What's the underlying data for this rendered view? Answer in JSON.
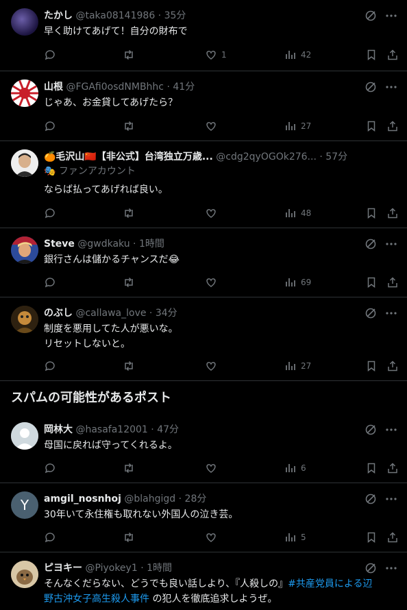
{
  "section_title": "スパムの可能性があるポスト",
  "tweets": [
    {
      "name": "たかし",
      "handle": "@taka08141986",
      "time": "35分",
      "text": [
        "早く助けてあげて！自分の財布で"
      ],
      "likes": "1",
      "views": "42"
    },
    {
      "name": "山根",
      "handle": "@FGAfi0osdNMBhhc",
      "time": "41分",
      "text": [
        "じゃあ、お金貸してあげたら？"
      ],
      "likes": "",
      "views": "27"
    },
    {
      "name": "🍊毛沢山🇨🇳【非公式】台湾独立万歳...",
      "handle": "@cdg2qyOGOk276...",
      "time": "57分",
      "sub": "ファンアカウント",
      "text": [
        "ならば払ってあげれば良い。"
      ],
      "likes": "",
      "views": "48"
    },
    {
      "name": "Steve",
      "handle": "@gwdkaku",
      "time": "1時間",
      "text": [
        "銀行さんは儲かるチャンスだ😂"
      ],
      "likes": "",
      "views": "69"
    },
    {
      "name": "のぶし",
      "handle": "@callawa_love",
      "time": "34分",
      "text": [
        "制度を悪用してた人が悪いな。",
        "リセットしないと。"
      ],
      "likes": "",
      "views": "27"
    },
    {
      "name": "岡林大",
      "handle": "@hasafa12001",
      "time": "47分",
      "text": [
        "母国に戻れば守ってくれるよ。"
      ],
      "likes": "",
      "views": "6"
    },
    {
      "name": "amgil_nosnhoj",
      "handle": "@blahgigd",
      "time": "28分",
      "avatar_letter": "Y",
      "text": [
        "30年いて永住権も取れない外国人の泣き芸。"
      ],
      "likes": "",
      "views": "5"
    },
    {
      "name": "ピヨキー",
      "handle": "@Piyokey1",
      "time": "1時間",
      "text_a": "そんなくだらない、どうでも良い話しより、『人殺しの』",
      "link1": "#共産党員による辺",
      "link2": "野古沖女子高生殺人事件",
      "text_b": " の犯人を徹底追求しようぜ。"
    }
  ]
}
